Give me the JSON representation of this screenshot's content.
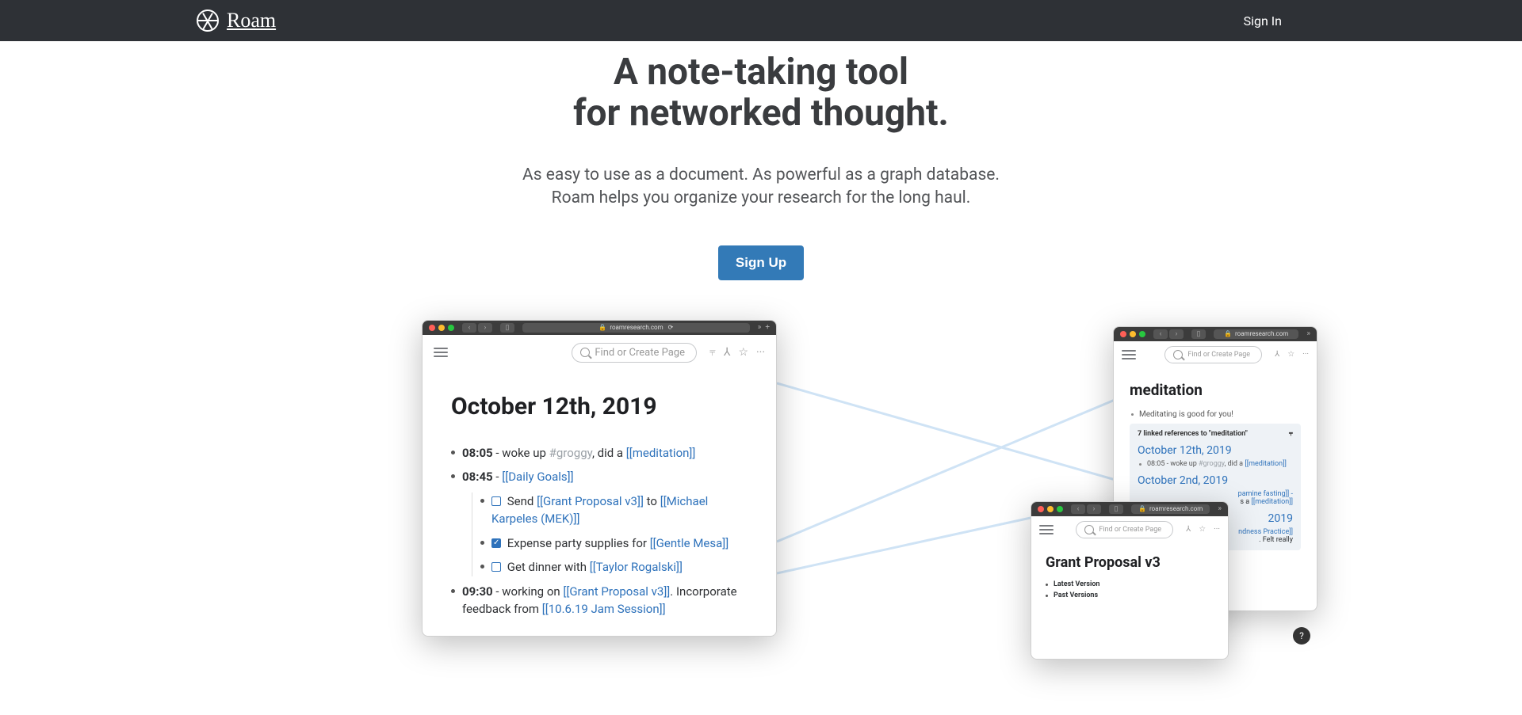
{
  "nav": {
    "brand": "Roam",
    "signin": "Sign In"
  },
  "hero": {
    "title_l1": "A note-taking tool",
    "title_l2": "for networked thought.",
    "sub_l1": "As easy to use as a document. As powerful as a graph database.",
    "sub_l2": "Roam helps you organize your research for the long haul.",
    "signup": "Sign Up"
  },
  "mock": {
    "url": "roamresearch.com",
    "search_ph": "Find or Create Page",
    "main": {
      "title": "October 12th, 2019",
      "bullets": {
        "b1_time": "08:05",
        "b1_text": " - woke up ",
        "b1_tag": "#groggy",
        "b1_text2": ", did a ",
        "b1_link": "[[meditation]]",
        "b2_time": "08:45",
        "b2_text": " - ",
        "b2_link": "[[Daily Goals]]",
        "b2a_text": "Send ",
        "b2a_l1": "[[Grant Proposal v3]]",
        "b2a_text2": " to ",
        "b2a_l2": "[[Michael Karpeles (MEK)]]",
        "b2b_text": "Expense party supplies for ",
        "b2b_l": "[[Gentle Mesa]]",
        "b2c_text": "Get dinner with ",
        "b2c_l": "[[Taylor Rogalski]]",
        "b3_time": "09:30",
        "b3_text": " - working on ",
        "b3_l": "[[Grant Proposal v3]]",
        "b3_text2": ". Incorporate feedback from ",
        "b3_l2": "[[10.6.19 Jam Session]]"
      }
    },
    "r1": {
      "title": "meditation",
      "bullet": "Meditating is good for you!",
      "refhdr": "7 linked references to \"meditation\"",
      "ref1_title": "October 12th, 2019",
      "ref1_item_a": "08:05 - woke up ",
      "ref1_item_tag": "#groggy",
      "ref1_item_b": ", did a ",
      "ref1_item_link": "[[meditation]]",
      "ref2_title": "October 2nd, 2019",
      "ref2_frag1": "pamine fasting]] -",
      "ref2_frag2": "s a ",
      "ref2_frag2_l": "[[meditation]]",
      "ref3_title": "2019",
      "ref3_l1": "ndness Practice]]",
      "ref3_t": ". Felt really"
    },
    "r2": {
      "title": "Grant Proposal v3",
      "i1": "Latest Version",
      "i2": "Past Versions"
    }
  }
}
